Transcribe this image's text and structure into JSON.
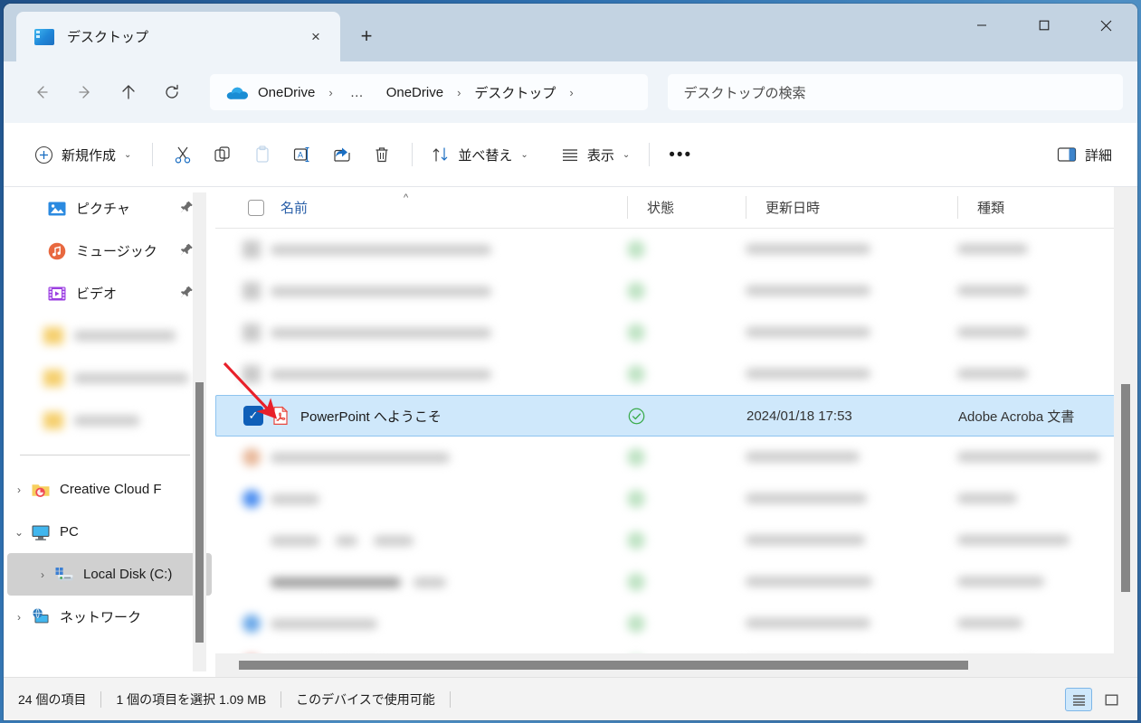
{
  "window": {
    "controls": {
      "minimize": "minimize-icon",
      "maximize": "maximize-icon",
      "close": "close-icon"
    }
  },
  "tabs": [
    {
      "title": "デスクトップ",
      "icon": "folder-desktop-icon",
      "close": "×"
    }
  ],
  "newtab": {
    "label": "+"
  },
  "navigation": {
    "back": "←",
    "forward": "→",
    "up": "↑",
    "refresh": "↻"
  },
  "breadcrumb": {
    "cloud_icon": "onedrive-cloud-icon",
    "items": [
      "OneDrive",
      "…",
      "OneDrive",
      "デスクトップ"
    ],
    "separator": "›",
    "trailing_separator": "›"
  },
  "search": {
    "placeholder": "デスクトップの検索",
    "value": ""
  },
  "toolbar": {
    "new_label": "新規作成",
    "new_chevron": "⌄",
    "cut": "cut-icon",
    "copy": "copy-icon",
    "paste": "paste-icon",
    "rename": "rename-icon",
    "share": "share-icon",
    "delete": "delete-icon",
    "sort_label": "並べ替え",
    "sort_chevron": "⌄",
    "view_label": "表示",
    "view_chevron": "⌄",
    "more": "•••",
    "details_label": "詳細"
  },
  "sidebar": {
    "items": [
      {
        "label": "ピクチャ",
        "icon": "pictures-icon",
        "pinned": true,
        "chevron": "",
        "indent": 1,
        "selected": false
      },
      {
        "label": "ミュージック",
        "icon": "music-icon",
        "pinned": true,
        "chevron": "",
        "indent": 1,
        "selected": false
      },
      {
        "label": "ビデオ",
        "icon": "videos-icon",
        "pinned": true,
        "chevron": "",
        "indent": 1,
        "selected": false
      }
    ],
    "redacted_count": 3,
    "tree": [
      {
        "label": "Creative Cloud F",
        "icon": "creative-cloud-folder-icon",
        "chevron": "›",
        "indent": 0,
        "selected": false
      },
      {
        "label": "PC",
        "icon": "pc-icon",
        "chevron": "⌄",
        "indent": 0,
        "selected": false
      },
      {
        "label": "Local Disk (C:)",
        "icon": "local-disk-icon",
        "chevron": "›",
        "indent": 2,
        "selected": true
      },
      {
        "label": "ネットワーク",
        "icon": "network-icon",
        "chevron": "›",
        "indent": 0,
        "selected": false
      }
    ]
  },
  "filelist": {
    "columns": [
      {
        "label": "名前",
        "sorted": true,
        "sort_direction": "^"
      },
      {
        "label": "状態",
        "sorted": false
      },
      {
        "label": "更新日時",
        "sorted": false
      },
      {
        "label": "種類",
        "sorted": false
      }
    ],
    "header_checkbox_checked": false,
    "rows_above_redacted": 4,
    "selected_row": {
      "checked": true,
      "check_glyph": "✓",
      "icon": "pdf-file-icon",
      "name": "PowerPoint へようこそ",
      "state": "synced-check-icon",
      "modified": "2024/01/18 17:53",
      "type": "Adobe Acroba 文書"
    },
    "rows_below_redacted": 7
  },
  "statusbar": {
    "item_count": "24 個の項目",
    "selection": "1 個の項目を選択  1.09 MB",
    "availability": "このデバイスで使用可能",
    "view_details": "details-view-icon",
    "view_large": "large-icons-view-icon"
  },
  "annotation": {
    "type": "red-arrow",
    "color": "#e8202a",
    "points_to": "selected-row-checkbox"
  },
  "colors": {
    "accent": "#0f5fb8",
    "selection_bg": "#cfe8fb",
    "selection_border": "#8ec4ef",
    "sorted_header": "#2a5fa8",
    "titlebar": "#c3d3e2",
    "addressbar": "#eff4f9",
    "sync_green": "#3aab4c"
  }
}
